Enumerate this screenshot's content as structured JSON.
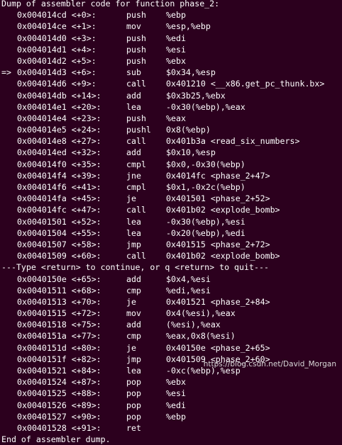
{
  "header": "Dump of assembler code for function phase_2:",
  "lines_part1": [
    {
      "arrow": "",
      "addr": "0x004014cd <+0>:",
      "mn": "push",
      "op": "%ebp"
    },
    {
      "arrow": "",
      "addr": "0x004014ce <+1>:",
      "mn": "mov",
      "op": "%esp,%ebp"
    },
    {
      "arrow": "",
      "addr": "0x004014d0 <+3>:",
      "mn": "push",
      "op": "%edi"
    },
    {
      "arrow": "",
      "addr": "0x004014d1 <+4>:",
      "mn": "push",
      "op": "%esi"
    },
    {
      "arrow": "",
      "addr": "0x004014d2 <+5>:",
      "mn": "push",
      "op": "%ebx"
    },
    {
      "arrow": "=>",
      "addr": "0x004014d3 <+6>:",
      "mn": "sub",
      "op": "$0x34,%esp"
    },
    {
      "arrow": "",
      "addr": "0x004014d6 <+9>:",
      "mn": "call",
      "op": "0x401210 <__x86.get_pc_thunk.bx>"
    },
    {
      "arrow": "",
      "addr": "0x004014db <+14>:",
      "mn": "add",
      "op": "$0x3b25,%ebx"
    },
    {
      "arrow": "",
      "addr": "0x004014e1 <+20>:",
      "mn": "lea",
      "op": "-0x30(%ebp),%eax"
    },
    {
      "arrow": "",
      "addr": "0x004014e4 <+23>:",
      "mn": "push",
      "op": "%eax"
    },
    {
      "arrow": "",
      "addr": "0x004014e5 <+24>:",
      "mn": "pushl",
      "op": "0x8(%ebp)"
    },
    {
      "arrow": "",
      "addr": "0x004014e8 <+27>:",
      "mn": "call",
      "op": "0x401b3a <read_six_numbers>"
    },
    {
      "arrow": "",
      "addr": "0x004014ed <+32>:",
      "mn": "add",
      "op": "$0x10,%esp"
    },
    {
      "arrow": "",
      "addr": "0x004014f0 <+35>:",
      "mn": "cmpl",
      "op": "$0x0,-0x30(%ebp)"
    },
    {
      "arrow": "",
      "addr": "0x004014f4 <+39>:",
      "mn": "jne",
      "op": "0x4014fc <phase_2+47>"
    },
    {
      "arrow": "",
      "addr": "0x004014f6 <+41>:",
      "mn": "cmpl",
      "op": "$0x1,-0x2c(%ebp)"
    },
    {
      "arrow": "",
      "addr": "0x004014fa <+45>:",
      "mn": "je",
      "op": "0x401501 <phase_2+52>"
    },
    {
      "arrow": "",
      "addr": "0x004014fc <+47>:",
      "mn": "call",
      "op": "0x401b02 <explode_bomb>"
    },
    {
      "arrow": "",
      "addr": "0x00401501 <+52>:",
      "mn": "lea",
      "op": "-0x30(%ebp),%esi"
    },
    {
      "arrow": "",
      "addr": "0x00401504 <+55>:",
      "mn": "lea",
      "op": "-0x20(%ebp),%edi"
    },
    {
      "arrow": "",
      "addr": "0x00401507 <+58>:",
      "mn": "jmp",
      "op": "0x401515 <phase_2+72>"
    },
    {
      "arrow": "",
      "addr": "0x00401509 <+60>:",
      "mn": "call",
      "op": "0x401b02 <explode_bomb>"
    }
  ],
  "pager_prompt": "---Type <return> to continue, or q <return> to quit---",
  "lines_part2": [
    {
      "arrow": "",
      "addr": "0x0040150e <+65>:",
      "mn": "add",
      "op": "$0x4,%esi"
    },
    {
      "arrow": "",
      "addr": "0x00401511 <+68>:",
      "mn": "cmp",
      "op": "%edi,%esi"
    },
    {
      "arrow": "",
      "addr": "0x00401513 <+70>:",
      "mn": "je",
      "op": "0x401521 <phase_2+84>"
    },
    {
      "arrow": "",
      "addr": "0x00401515 <+72>:",
      "mn": "mov",
      "op": "0x4(%esi),%eax"
    },
    {
      "arrow": "",
      "addr": "0x00401518 <+75>:",
      "mn": "add",
      "op": "(%esi),%eax"
    },
    {
      "arrow": "",
      "addr": "0x0040151a <+77>:",
      "mn": "cmp",
      "op": "%eax,0x8(%esi)"
    },
    {
      "arrow": "",
      "addr": "0x0040151d <+80>:",
      "mn": "je",
      "op": "0x40150e <phase_2+65>"
    },
    {
      "arrow": "",
      "addr": "0x0040151f <+82>:",
      "mn": "jmp",
      "op": "0x401509 <phase_2+60>"
    },
    {
      "arrow": "",
      "addr": "0x00401521 <+84>:",
      "mn": "lea",
      "op": "-0xc(%ebp),%esp"
    },
    {
      "arrow": "",
      "addr": "0x00401524 <+87>:",
      "mn": "pop",
      "op": "%ebx"
    },
    {
      "arrow": "",
      "addr": "0x00401525 <+88>:",
      "mn": "pop",
      "op": "%esi"
    },
    {
      "arrow": "",
      "addr": "0x00401526 <+89>:",
      "mn": "pop",
      "op": "%edi"
    },
    {
      "arrow": "",
      "addr": "0x00401527 <+90>:",
      "mn": "pop",
      "op": "%ebp"
    },
    {
      "arrow": "",
      "addr": "0x00401528 <+91>:",
      "mn": "ret",
      "op": ""
    }
  ],
  "footer": "End of assembler dump.",
  "watermark": "https://blog.csdn.net/David_Morgan",
  "colors": {
    "background": "#2c001e",
    "text": "#ffffff"
  }
}
